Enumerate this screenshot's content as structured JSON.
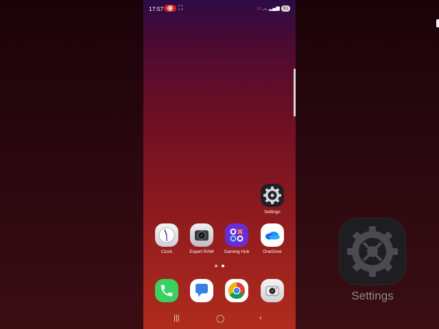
{
  "status_bar": {
    "time": "17:57",
    "battery": "81"
  },
  "home": {
    "settings_app": {
      "label": "Settings"
    },
    "apps_row": [
      {
        "label": "Clock"
      },
      {
        "label": "Expert RAW"
      },
      {
        "label": "Gaming Hub"
      },
      {
        "label": "OneDrive"
      }
    ],
    "page_indicator": {
      "pages": 2,
      "current": 2
    }
  },
  "dock": [
    {
      "name": "phone"
    },
    {
      "name": "messages"
    },
    {
      "name": "chrome"
    },
    {
      "name": "camera"
    }
  ],
  "zoomed_preview": {
    "label": "Settings"
  },
  "colors": {
    "accent_gaming": "#6b2bd6",
    "phone_green": "#39d160",
    "recording_red": "#d21f1f"
  }
}
